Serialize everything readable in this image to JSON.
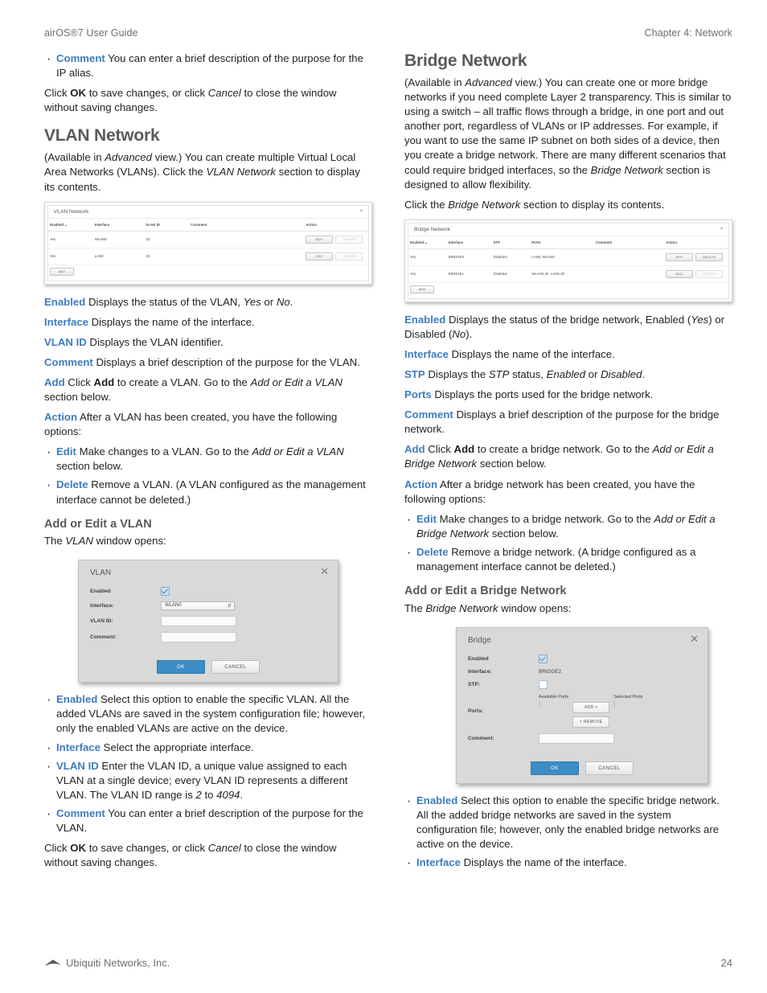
{
  "runhead": {
    "left": "airOS®7 User Guide",
    "right": "Chapter 4: Network"
  },
  "footer": {
    "company": "Ubiquiti Networks, Inc.",
    "page_number": "24",
    "logo_icon": "ubiquiti-logo-icon"
  },
  "colors": {
    "term_blue": "#3d7cc0",
    "heading_gray": "#5a5a5d",
    "primary_button": "#3d8dc4"
  },
  "left_column": {
    "lead_bullet": {
      "term": "Comment",
      "text": "  You can enter a brief description of the purpose for the IP alias."
    },
    "lead_paragraph": {
      "pre": "Click ",
      "bold1": "OK",
      "mid": " to save changes, or click ",
      "italic1": "Cancel",
      "post": " to close the window without saving changes."
    },
    "vlan_heading": "VLAN Network",
    "vlan_intro": {
      "pre": "(Available in ",
      "italic1": "Advanced",
      "mid": " view.) You can create multiple Virtual Local Area Networks (VLANs). Click the ",
      "italic2": "VLAN Network",
      "post": " section to display its contents."
    },
    "vlan_shot": {
      "title": "VLAN Network",
      "collapse_icon": "chevron-down-icon",
      "columns": [
        "Enabled",
        "Interface",
        "VLAN ID",
        "Comment",
        "Action"
      ],
      "sort_marker": "▲",
      "rows": [
        {
          "enabled": "Yes",
          "interface": "WLAN0",
          "vlan_id": "20",
          "comment": "",
          "edit": "EDIT",
          "delete": "DELETE"
        },
        {
          "enabled": "Yes",
          "interface": "LAN0",
          "vlan_id": "20",
          "comment": "",
          "edit": "EDIT",
          "delete": "DELETE"
        }
      ],
      "add_button": "ADD"
    },
    "terms": [
      {
        "term": "Enabled",
        "pre": "  Displays the status of the VLAN, ",
        "italic1": "Yes",
        "mid": " or ",
        "italic2": "No",
        "post": "."
      },
      {
        "term": "Interface",
        "pre": "  Displays the name of the interface.",
        "italic1": "",
        "mid": "",
        "italic2": "",
        "post": ""
      },
      {
        "term": "VLAN ID",
        "pre": "  Displays the VLAN identifier.",
        "italic1": "",
        "mid": "",
        "italic2": "",
        "post": ""
      },
      {
        "term": "Comment",
        "pre": "  Displays a brief description of the purpose for the VLAN.",
        "italic1": "",
        "mid": "",
        "italic2": "",
        "post": ""
      }
    ],
    "add_term": {
      "term": "Add",
      "pre": "  Click ",
      "bold1": "Add",
      "mid": " to create a VLAN. Go to the ",
      "italic1": "Add or Edit a VLAN",
      "post": " section below."
    },
    "action_term": {
      "term": "Action",
      "text": "  After a VLAN has been created, you have the following options:"
    },
    "action_bullets": [
      {
        "term": "Edit",
        "pre": "  Make changes to a VLAN. Go to the ",
        "italic1": "Add or Edit a VLAN",
        "post": " section below."
      },
      {
        "term": "Delete",
        "pre": "  Remove a VLAN. (A VLAN configured as the management interface cannot be deleted.)",
        "italic1": "",
        "post": ""
      }
    ],
    "addedit_heading": "Add or Edit a VLAN",
    "addedit_intro": {
      "pre": "The ",
      "italic1": "VLAN",
      "post": " window opens:"
    },
    "vlan_dialog": {
      "title": "VLAN",
      "close_icon": "close-icon",
      "enabled_label": "Enabled",
      "enabled_checked": true,
      "interface_label": "Interface:",
      "interface_value": "WLAN0",
      "vlan_id_label": "VLAN ID:",
      "vlan_id_value": "",
      "comment_label": "Comment:",
      "comment_value": "",
      "ok_label": "OK",
      "cancel_label": "CANCEL"
    },
    "dialog_bullets": [
      {
        "term": "Enabled",
        "pre": "  Select this option to enable the specific VLAN. All the added VLANs are saved in the system configuration file; however, only the enabled VLANs are active on the device.",
        "italic1": "",
        "mid": "",
        "italic2": "",
        "post": ""
      },
      {
        "term": "Interface",
        "pre": "  Select the appropriate interface.",
        "italic1": "",
        "mid": "",
        "italic2": "",
        "post": ""
      },
      {
        "term": "VLAN ID",
        "pre": "  Enter the VLAN ID, a unique value assigned to each VLAN at a single device; every VLAN ID represents a different VLAN. The VLAN ID range is ",
        "italic1": "2",
        "mid": " to ",
        "italic2": "4094",
        "post": "."
      },
      {
        "term": "Comment",
        "pre": "  You can enter a brief description of the purpose for the VLAN.",
        "italic1": "",
        "mid": "",
        "italic2": "",
        "post": ""
      }
    ],
    "closing_paragraph": {
      "pre": "Click ",
      "bold1": "OK",
      "mid": " to save changes, or click ",
      "italic1": "Cancel",
      "post": " to close the window without saving changes."
    }
  },
  "right_column": {
    "bridge_heading": "Bridge Network",
    "bridge_intro": {
      "pre": "(Available in ",
      "italic1": "Advanced",
      "mid": " view.) You can create one or more bridge networks if you need complete Layer 2 transparency. This is similar to using a switch – all traffic flows through a bridge, in one port and out another port, regardless of VLANs or IP addresses. For example, if you want to use the same IP subnet on both sides of a device, then you create a bridge network. There are many different scenarios that could require bridged interfaces, so the ",
      "italic2": "Bridge Network",
      "post": " section is designed to allow flexibility."
    },
    "bridge_click": {
      "pre": "Click the ",
      "italic1": "Bridge Network",
      "post": " section to display its contents."
    },
    "bridge_shot": {
      "title": "Bridge Network",
      "collapse_icon": "chevron-down-icon",
      "columns": [
        "Enabled",
        "Interface",
        "STP",
        "Ports",
        "Comment",
        "Action"
      ],
      "sort_marker": "▲",
      "rows": [
        {
          "enabled": "Yes",
          "interface": "BRIDGE0",
          "stp": "Disabled",
          "ports": "LAN0, WLAN0",
          "comment": "",
          "edit": "EDIT",
          "delete": "DELETE"
        },
        {
          "enabled": "Yes",
          "interface": "BRIDGE1",
          "stp": "Disabled",
          "ports": "WLAN0.20, LAN0.20",
          "comment": "",
          "edit": "EDIT",
          "delete": "DELETE"
        }
      ],
      "add_button": "ADD"
    },
    "terms": [
      {
        "term": "Enabled",
        "pre": "  Displays the status of the bridge network, Enabled (",
        "italic1": "Yes",
        "mid": ") or Disabled (",
        "italic2": "No",
        "post": ")."
      },
      {
        "term": "Interface",
        "pre": "  Displays the name of the interface.",
        "italic1": "",
        "mid": "",
        "italic2": "",
        "post": ""
      },
      {
        "term": "STP",
        "pre": "  Displays the ",
        "italic1": "STP",
        "mid": " status, ",
        "italic2": "Enabled",
        "post": " or ",
        "italic3": "Disabled",
        "tail": "."
      },
      {
        "term": "Ports",
        "pre": "  Displays the ports used for the bridge network.",
        "italic1": "",
        "mid": "",
        "italic2": "",
        "post": ""
      },
      {
        "term": "Comment",
        "pre": "  Displays a brief description of the purpose for the bridge network.",
        "italic1": "",
        "mid": "",
        "italic2": "",
        "post": ""
      }
    ],
    "add_term": {
      "term": "Add",
      "pre": "  Click ",
      "bold1": "Add",
      "mid": " to create a bridge network. Go to the ",
      "italic1": "Add or Edit a Bridge Network",
      "post": " section below."
    },
    "action_term": {
      "term": "Action",
      "text": "  After a bridge network has been created, you have the following options:"
    },
    "action_bullets": [
      {
        "term": "Edit",
        "pre": "  Make changes to a bridge network. Go to the ",
        "italic1": "Add or Edit a Bridge Network",
        "post": " section below."
      },
      {
        "term": "Delete",
        "pre": "  Remove a bridge network. (A bridge configured as a management interface cannot be deleted.)",
        "italic1": "",
        "post": ""
      }
    ],
    "addedit_heading": "Add or Edit a Bridge Network",
    "addedit_intro": {
      "pre": "The ",
      "italic1": "Bridge Network",
      "post": " window opens:"
    },
    "bridge_dialog": {
      "title": "Bridge",
      "close_icon": "close-icon",
      "enabled_label": "Enabled",
      "enabled_checked": true,
      "interface_label": "Interface:",
      "interface_value": "BRIDGE2",
      "stp_label": "STP:",
      "stp_checked": false,
      "ports_label": "Ports:",
      "available_ports_label": "Available Ports",
      "selected_ports_label": "Selected Ports",
      "add_label": "ADD >",
      "remove_label": "< REMOVE",
      "comment_label": "Comment:",
      "comment_value": "",
      "ok_label": "OK",
      "cancel_label": "CANCEL"
    },
    "dialog_bullets": [
      {
        "term": "Enabled",
        "pre": "  Select this option to enable the specific bridge network. All the added bridge networks are saved in the system configuration file; however, only the enabled bridge networks are active on the device."
      },
      {
        "term": "Interface",
        "pre": "  Displays the name of the interface."
      }
    ]
  }
}
